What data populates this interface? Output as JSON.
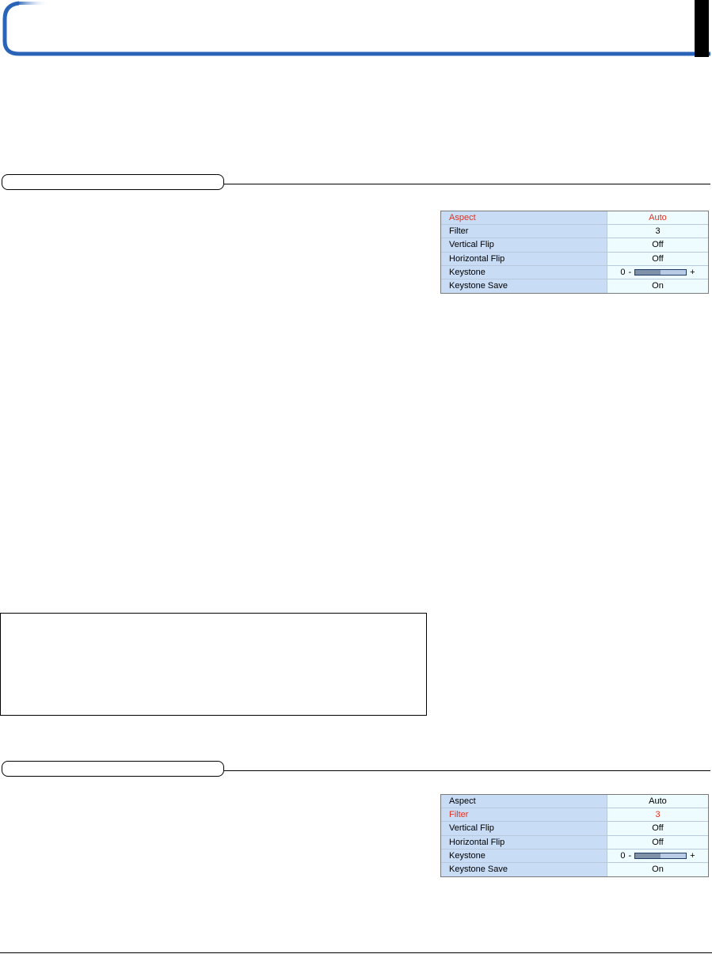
{
  "osd_menus": [
    {
      "rows": [
        {
          "label": "Aspect",
          "value": "Auto",
          "active": true
        },
        {
          "label": "Filter",
          "value": "3",
          "active": false
        },
        {
          "label": "Vertical Flip",
          "value": "Off",
          "active": false
        },
        {
          "label": "Horizontal Flip",
          "value": "Off",
          "active": false
        },
        {
          "label": "Keystone",
          "value": "0",
          "minus": "-",
          "plus": "+",
          "level": 0.5,
          "active": false
        },
        {
          "label": "Keystone Save",
          "value": "On",
          "active": false
        }
      ]
    },
    {
      "rows": [
        {
          "label": "Aspect",
          "value": "Auto",
          "active": false
        },
        {
          "label": "Filter",
          "value": "3",
          "active": true
        },
        {
          "label": "Vertical Flip",
          "value": "Off",
          "active": false
        },
        {
          "label": "Horizontal Flip",
          "value": "Off",
          "active": false
        },
        {
          "label": "Keystone",
          "value": "0",
          "minus": "-",
          "plus": "+",
          "level": 0.5,
          "active": false
        },
        {
          "label": "Keystone Save",
          "value": "On",
          "active": false
        }
      ]
    }
  ],
  "colors": {
    "header_gradient_start": "#2a64b8",
    "header_gradient_end": "#ffffff",
    "osd_label_bg": "#c9dcf5",
    "osd_value_bg": "#eefcff",
    "highlight_text": "#e0301e"
  }
}
